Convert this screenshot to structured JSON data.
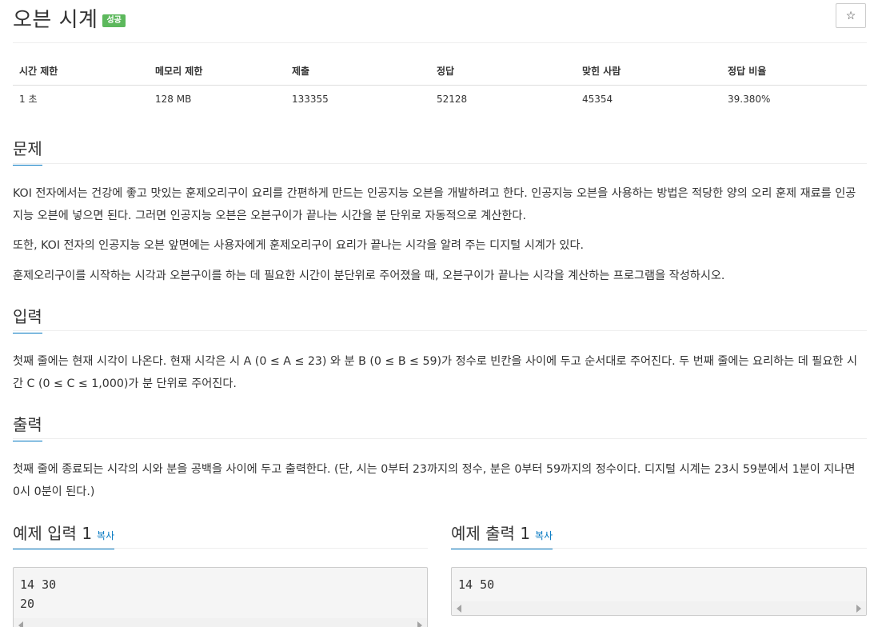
{
  "problem": {
    "title": "오븐 시계",
    "status_badge": "성공",
    "star_icon": "☆"
  },
  "stats": {
    "headers": [
      "시간 제한",
      "메모리 제한",
      "제출",
      "정답",
      "맞힌 사람",
      "정답 비율"
    ],
    "values": [
      "1 초",
      "128 MB",
      "133355",
      "52128",
      "45354",
      "39.380%"
    ]
  },
  "sections": {
    "description": {
      "heading": "문제",
      "paragraphs": [
        "KOI 전자에서는 건강에 좋고 맛있는 훈제오리구이 요리를 간편하게 만드는 인공지능 오븐을 개발하려고 한다. 인공지능 오븐을 사용하는 방법은 적당한 양의 오리 훈제 재료를 인공지능 오븐에 넣으면 된다. 그러면 인공지능 오븐은 오븐구이가 끝나는 시간을 분 단위로 자동적으로 계산한다.",
        "또한, KOI 전자의 인공지능 오븐 앞면에는 사용자에게 훈제오리구이 요리가 끝나는 시각을 알려 주는 디지털 시계가 있다.",
        "훈제오리구이를 시작하는 시각과 오븐구이를 하는 데 필요한 시간이 분단위로 주어졌을 때, 오븐구이가 끝나는 시각을 계산하는 프로그램을 작성하시오."
      ]
    },
    "input": {
      "heading": "입력",
      "paragraph": "첫째 줄에는 현재 시각이 나온다. 현재 시각은 시 A (0 ≤ A ≤ 23) 와 분 B (0 ≤ B ≤ 59)가 정수로 빈칸을 사이에 두고 순서대로 주어진다. 두 번째 줄에는 요리하는 데 필요한 시간 C (0 ≤ C ≤ 1,000)가 분 단위로 주어진다."
    },
    "output": {
      "heading": "출력",
      "paragraph": "첫째 줄에 종료되는 시각의 시와 분을 공백을 사이에 두고 출력한다. (단, 시는 0부터 23까지의 정수, 분은 0부터 59까지의 정수이다. 디지털 시계는 23시 59분에서 1분이 지나면 0시 0분이 된다.)"
    }
  },
  "samples": {
    "input": {
      "heading": "예제 입력 1",
      "copy_label": "복사",
      "lines": [
        "14 30",
        "20"
      ]
    },
    "output": {
      "heading": "예제 출력 1",
      "copy_label": "복사",
      "lines": [
        "14 50"
      ]
    }
  }
}
